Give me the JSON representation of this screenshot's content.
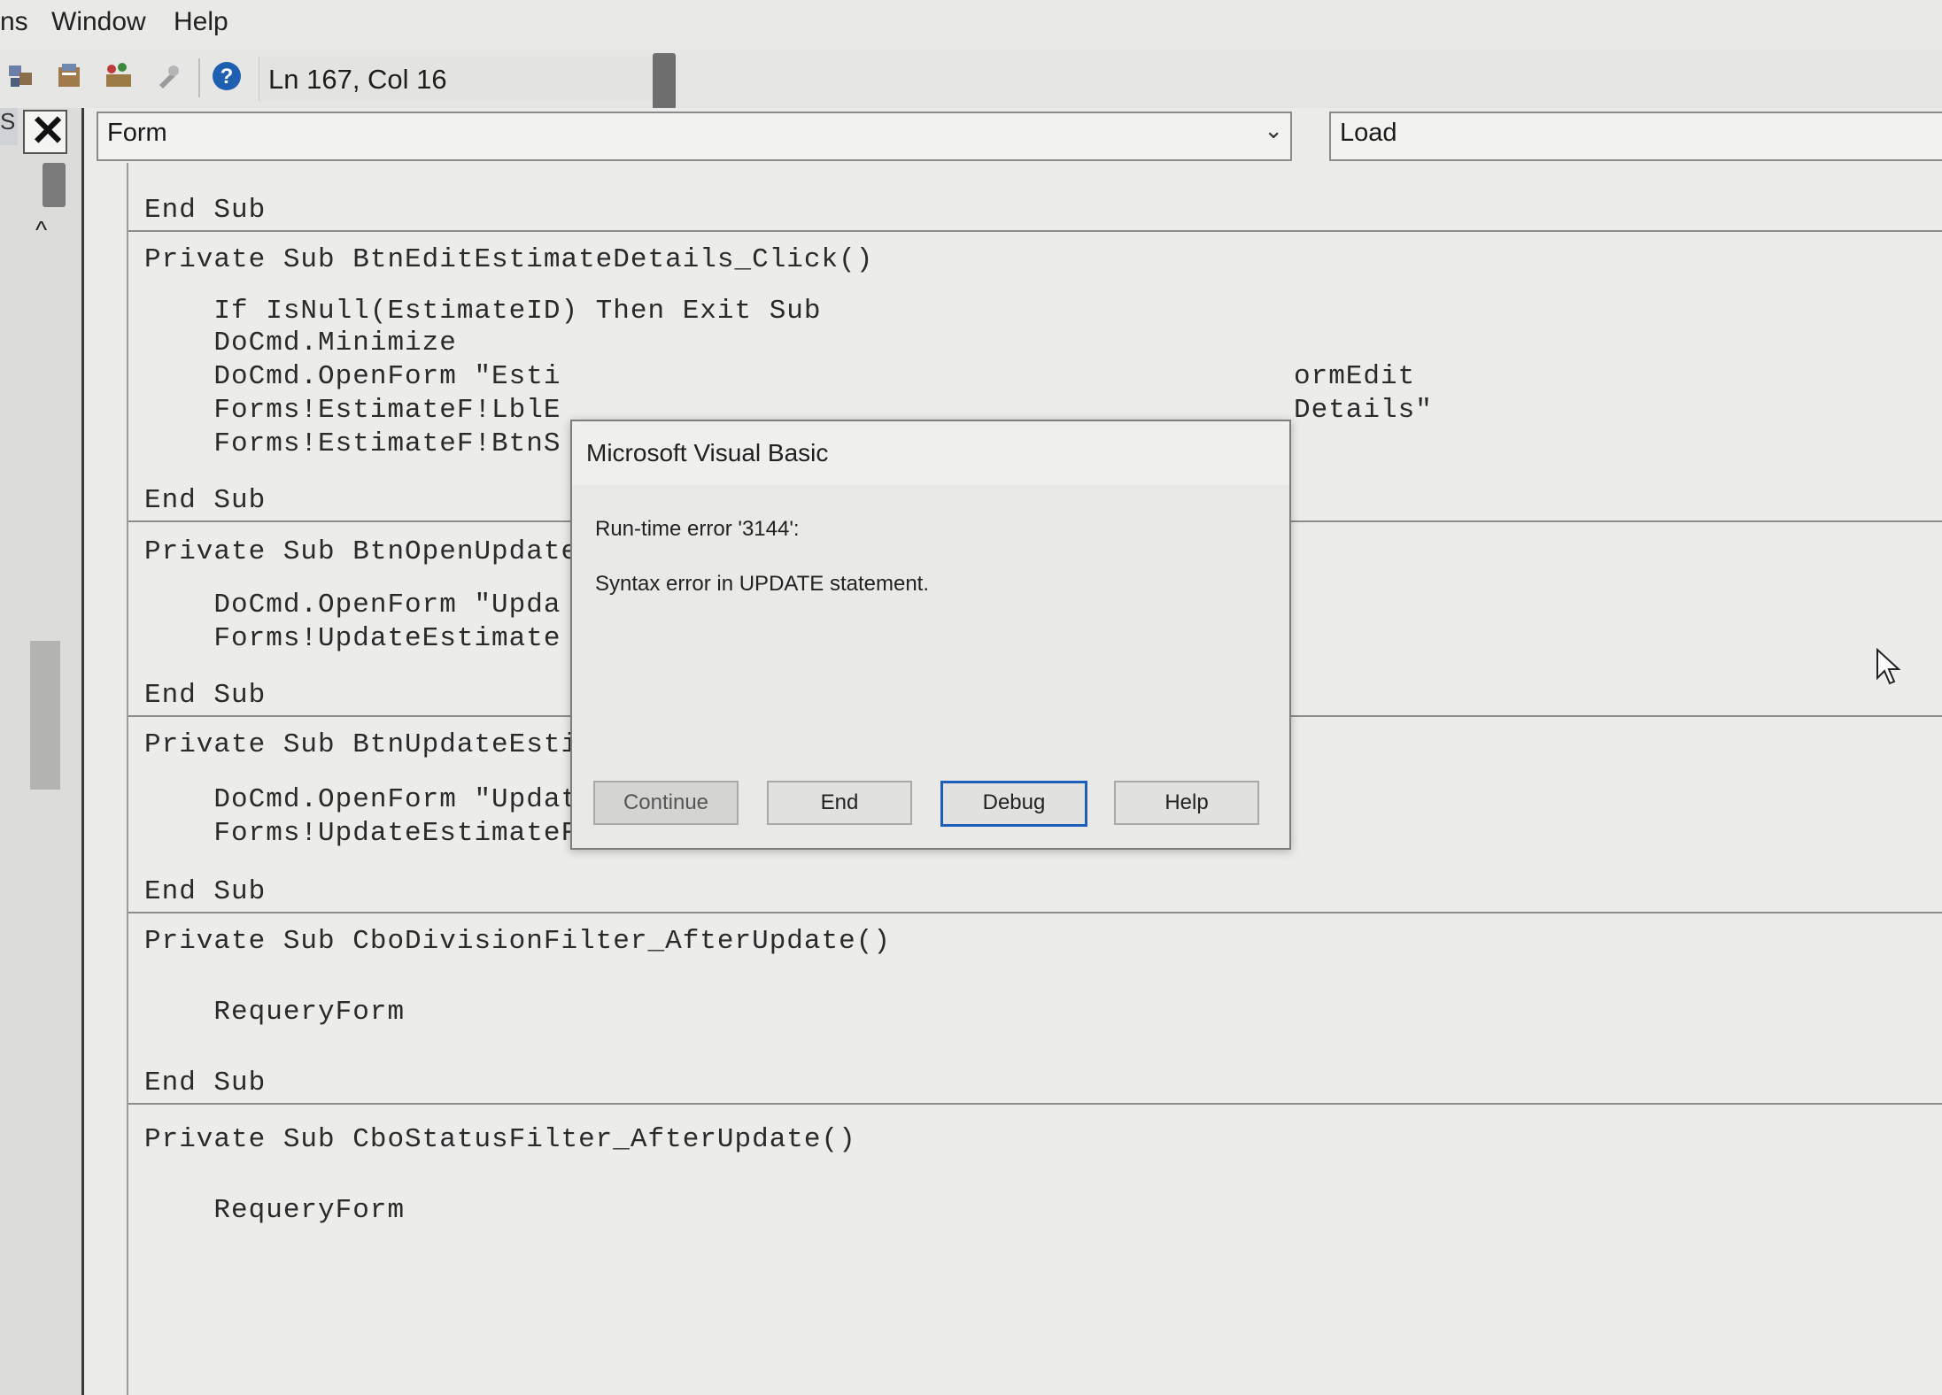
{
  "menubar": {
    "items": [
      "ns",
      "Window",
      "Help"
    ]
  },
  "toolbar": {
    "icons": [
      "project-explorer-icon",
      "properties-window-icon",
      "object-browser-icon",
      "toolbox-icon",
      "help-icon"
    ],
    "status": "Ln 167, Col 16"
  },
  "left_panel": {
    "cut_label": "S",
    "close_symbol": "✕",
    "scroll_up_symbol": "^"
  },
  "code_window": {
    "object_combo": "Form",
    "procedure_combo": "Load",
    "combo_arrow": "⌄",
    "lines": [
      "End Sub",
      "Private Sub BtnEditEstimateDetails_Click()",
      "    If IsNull(EstimateID) Then Exit Sub",
      "    DoCmd.Minimize",
      "    DoCmd.OpenForm \"Esti",
      "ormEdit",
      "    Forms!EstimateF!LblE",
      "Details\"",
      "    Forms!EstimateF!BtnS",
      "End Sub",
      "Private Sub BtnOpenUpdate",
      "    DoCmd.OpenForm \"Upda",
      "    Forms!UpdateEstimate",
      "End Sub",
      "Private Sub BtnUpdateEstimate_Click()",
      "    DoCmd.OpenForm \"UpdateEstimateF\"",
      "    Forms!UpdateEstimateF!EstimateID = EstimateID",
      "End Sub",
      "Private Sub CboDivisionFilter_AfterUpdate()",
      "    RequeryForm",
      "End Sub",
      "Private Sub CboStatusFilter_AfterUpdate()",
      "    RequeryForm"
    ]
  },
  "dialog": {
    "title": "Microsoft Visual Basic",
    "error_line": "Run-time error '3144':",
    "message": "Syntax error in UPDATE statement.",
    "buttons": {
      "continue": "Continue",
      "end": "End",
      "debug": "Debug",
      "help": "Help"
    },
    "continue_enabled": false,
    "default_button": "Debug",
    "accent_color": "#1d5fb8"
  }
}
